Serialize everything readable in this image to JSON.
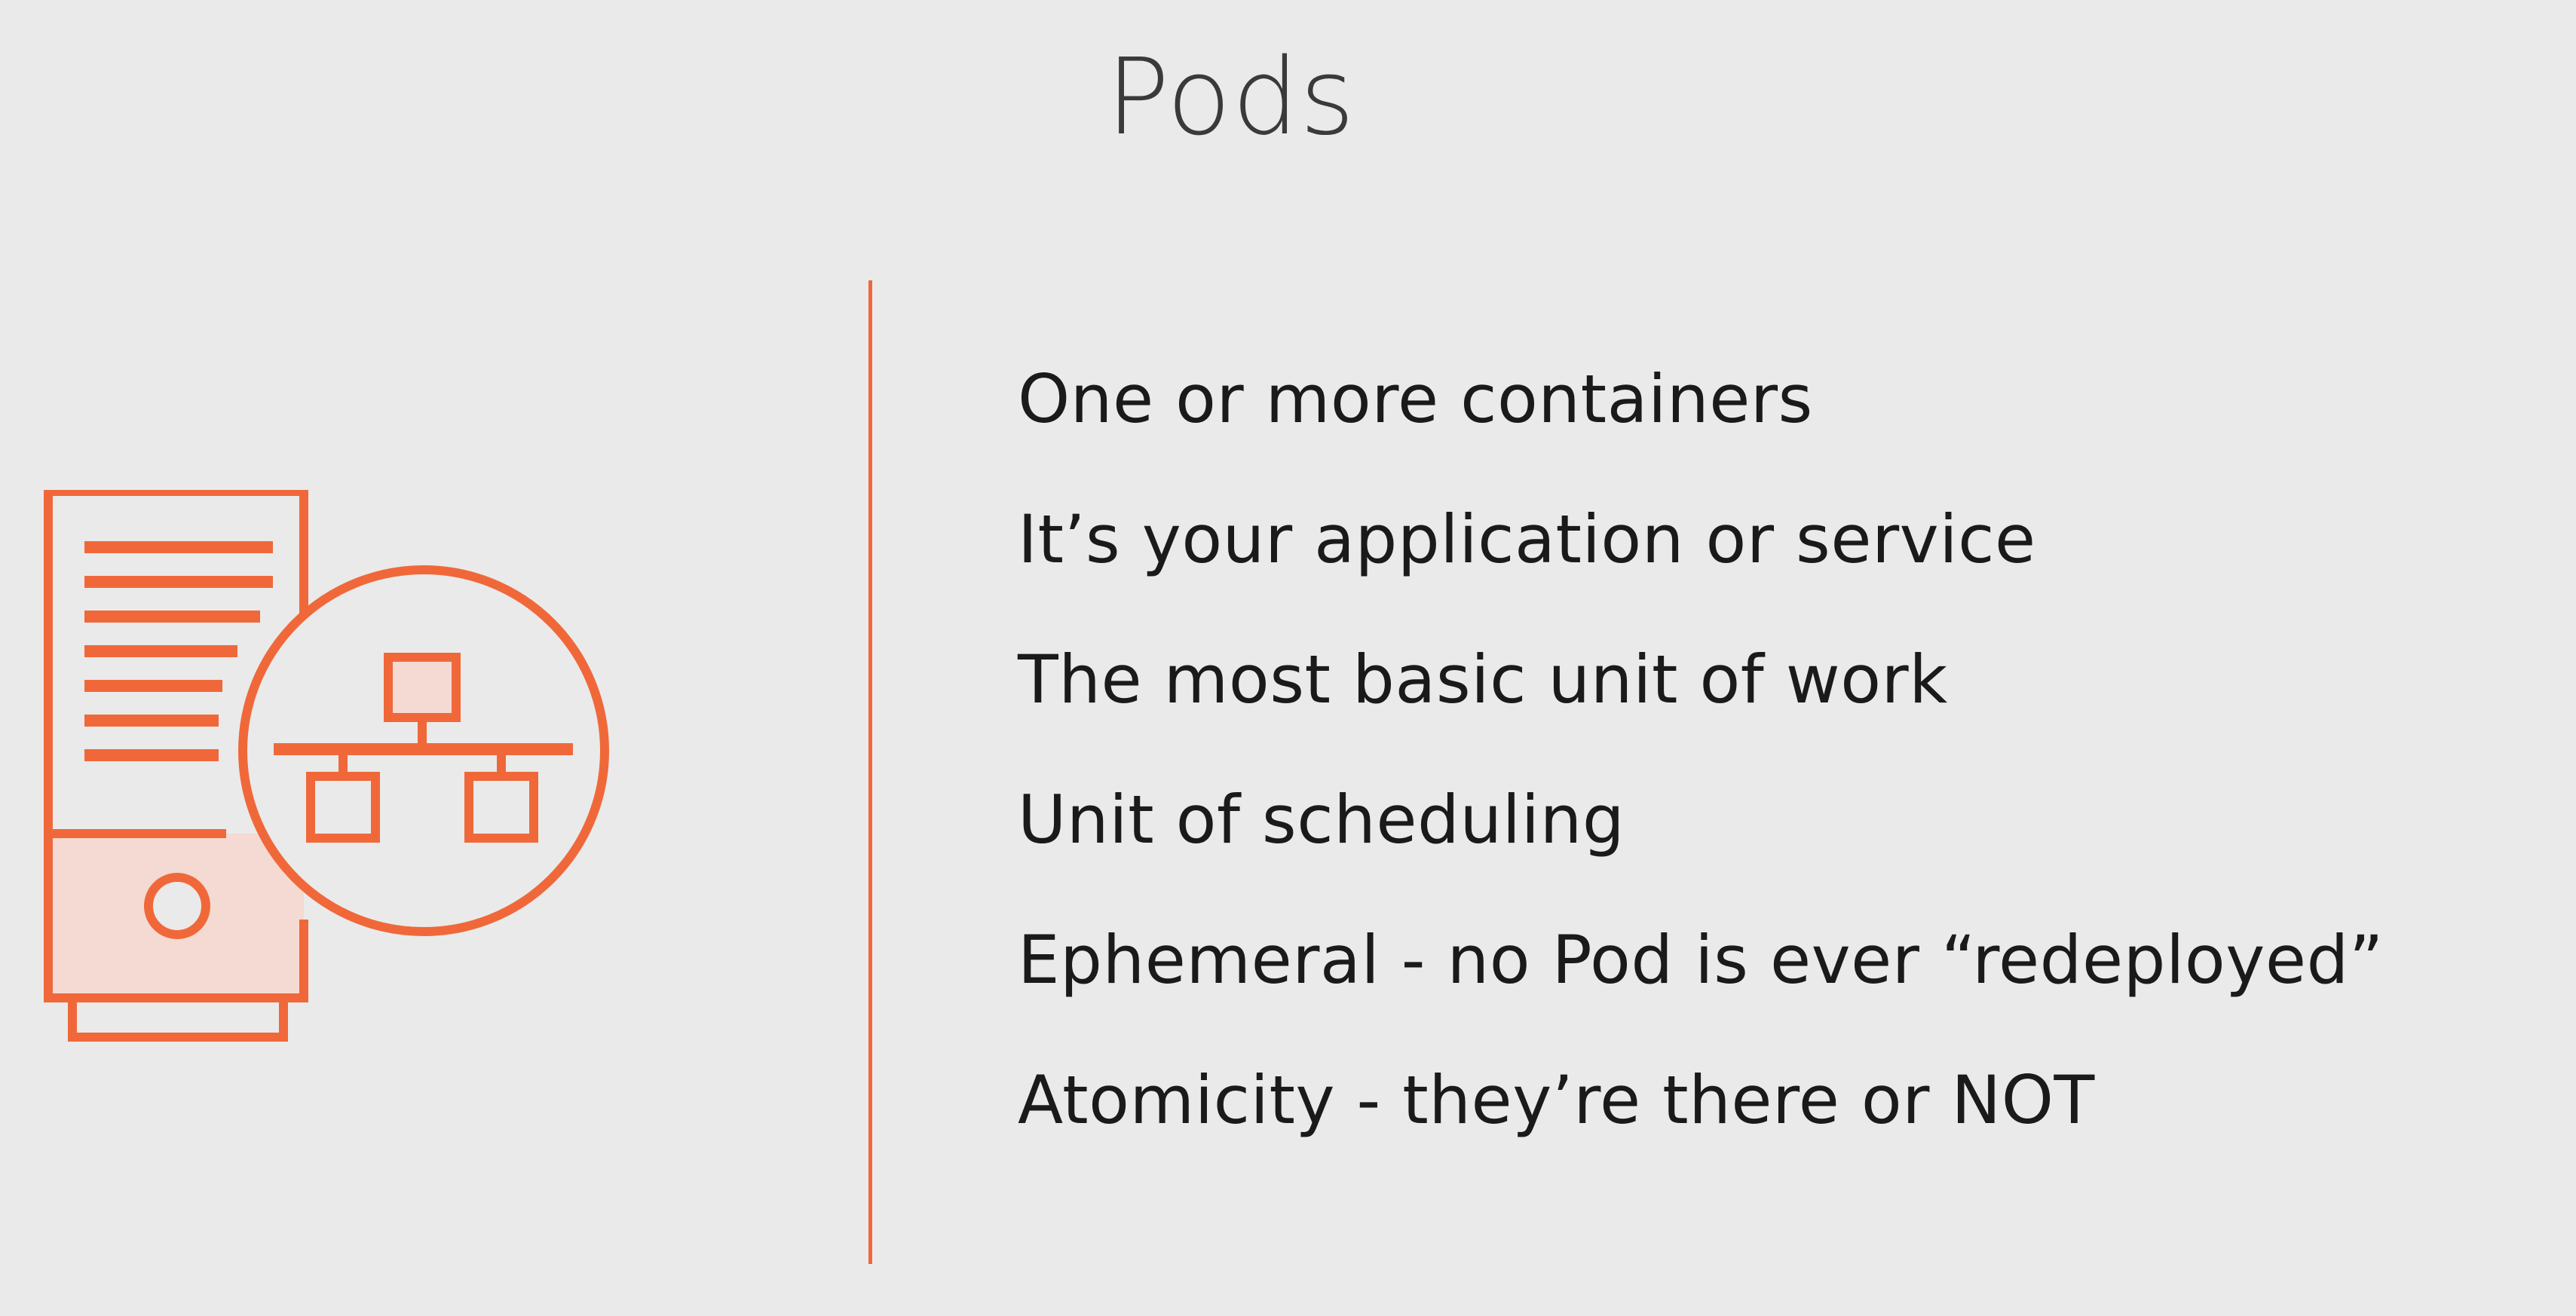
{
  "slide": {
    "title": "Pods",
    "accent_color": "#F0683A",
    "background_color": "#EAEAEA",
    "icon": "server-network-icon",
    "bullets": [
      "One or more containers",
      "It’s your application or service",
      "The most basic unit of work",
      "Unit of scheduling",
      "Ephemeral - no Pod is ever “redeployed”",
      "Atomicity - they’re there or NOT"
    ]
  }
}
